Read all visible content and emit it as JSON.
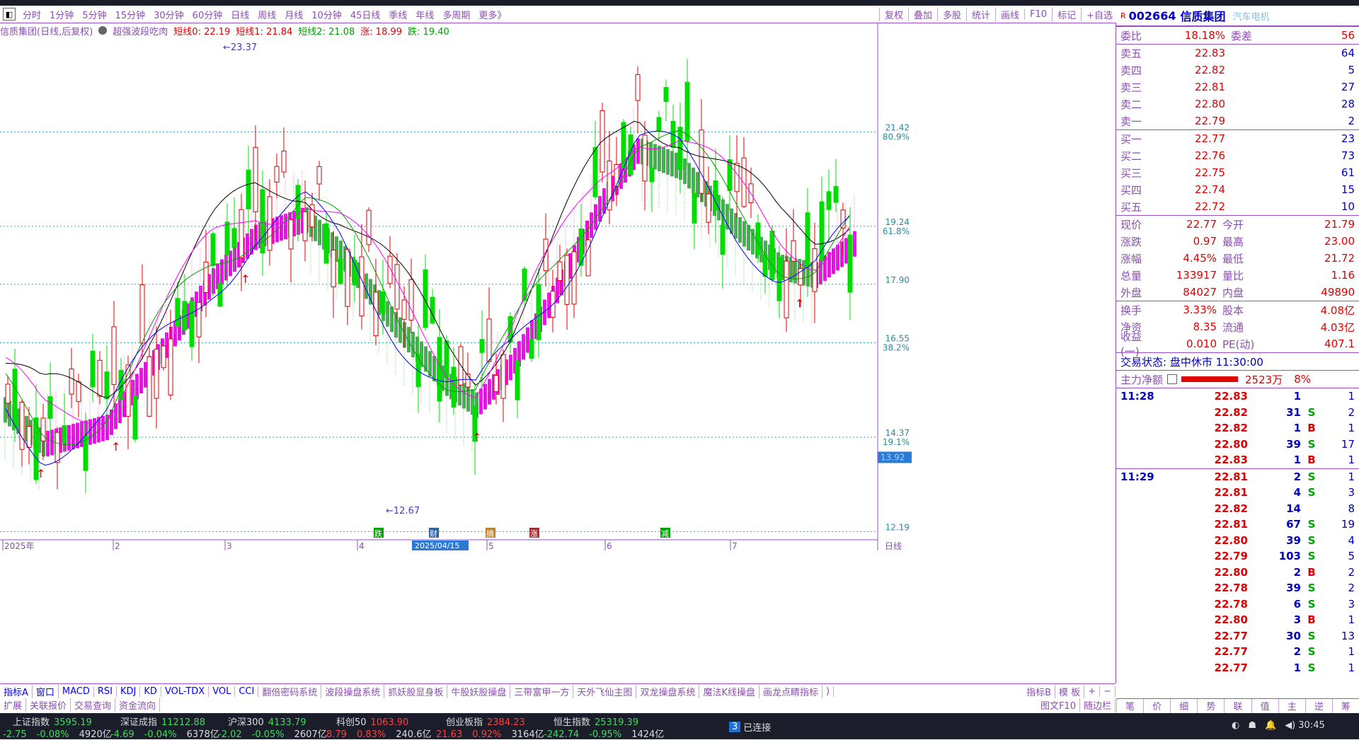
{
  "topbar": {
    "tabs": [
      "分时",
      "1分钟",
      "5分钟",
      "15分钟",
      "30分钟",
      "60分钟",
      "日线",
      "周线",
      "月线",
      "10分钟",
      "45日线",
      "季线",
      "年线",
      "多周期",
      "更多》"
    ],
    "right_buttons": [
      "复权",
      "叠加",
      "多股",
      "统计",
      "画线",
      "F10",
      "标记",
      "+自选",
      "返回"
    ]
  },
  "indicator_line": {
    "name": "信质集团(日线,后复权)",
    "formula": "超强波段吃肉",
    "items": [
      {
        "label": "短线0:",
        "value": "22.19",
        "color": "#e00000"
      },
      {
        "label": "短线1:",
        "value": "21.84",
        "color": "#e00000"
      },
      {
        "label": "短线2:",
        "value": "21.08",
        "color": "#00a000"
      },
      {
        "label": "涨:",
        "value": "18.99",
        "color": "#e00000"
      },
      {
        "label": "跌:",
        "value": "19.40",
        "color": "#00a000"
      }
    ]
  },
  "price_axis": [
    {
      "price": "21.42",
      "pct": "80.9%"
    },
    {
      "price": "19.24",
      "pct": "61.8%"
    },
    {
      "price": "17.90",
      "pct": ""
    },
    {
      "price": "16.55",
      "pct": "38.2%"
    },
    {
      "price": "14.37",
      "pct": "19.1%"
    },
    {
      "price": "12.19",
      "pct": ""
    }
  ],
  "price_markers": {
    "high": "23.37",
    "low": "12.67",
    "current_box": "13.92"
  },
  "x_axis": {
    "labels": [
      "2025年",
      "2",
      "3",
      "4",
      "5",
      "6",
      "7"
    ],
    "selected_date": "2025/04/15",
    "unit": "日线"
  },
  "event_marks": [
    "跌",
    "财",
    "摘",
    "涨",
    "减"
  ],
  "bottom_tabs_row1": [
    "指标A",
    "窗口",
    "MACD",
    "RSI",
    "KDJ",
    "KD",
    "VOL-TDX",
    "VOL",
    "CCI",
    "翻倍密码系统",
    "波段操盘系统",
    "抓妖股显身板",
    "牛股妖股操盘",
    "三带富甲一方",
    "天外飞仙主图",
    "双龙操盘系统",
    "魔法K线操盘",
    "画龙点睛指标",
    ")"
  ],
  "bottom_tabs_row1_right": [
    "指标B",
    "模 板",
    "+",
    "−"
  ],
  "bottom_tabs_row2": [
    "扩展",
    "关联报价",
    "交易查询",
    "资金流向"
  ],
  "bottom_tabs_row2_right": [
    "图文F10",
    "随边栏"
  ],
  "stock": {
    "code": "002664",
    "name": "信质集团",
    "sector": "汽车电机"
  },
  "order_ratio": {
    "label1": "委比",
    "v1": "18.18%",
    "label2": "委差",
    "v2": "56"
  },
  "asks": [
    {
      "label": "卖五",
      "price": "22.83",
      "vol": "64"
    },
    {
      "label": "卖四",
      "price": "22.82",
      "vol": "5"
    },
    {
      "label": "卖三",
      "price": "22.81",
      "vol": "27"
    },
    {
      "label": "卖二",
      "price": "22.80",
      "vol": "28"
    },
    {
      "label": "卖一",
      "price": "22.79",
      "vol": "2"
    }
  ],
  "bids": [
    {
      "label": "买一",
      "price": "22.77",
      "vol": "23"
    },
    {
      "label": "买二",
      "price": "22.76",
      "vol": "73"
    },
    {
      "label": "买三",
      "price": "22.75",
      "vol": "61"
    },
    {
      "label": "买四",
      "price": "22.74",
      "vol": "15"
    },
    {
      "label": "买五",
      "price": "22.72",
      "vol": "10"
    }
  ],
  "quote_block1": [
    {
      "l1": "现价",
      "v1": "22.77",
      "l2": "今开",
      "v2": "21.79"
    },
    {
      "l1": "涨跌",
      "v1": "0.97",
      "l2": "最高",
      "v2": "23.00"
    },
    {
      "l1": "涨幅",
      "v1": "4.45%",
      "l2": "最低",
      "v2": "21.72"
    },
    {
      "l1": "总量",
      "v1": "133917",
      "l2": "量比",
      "v2": "1.16"
    },
    {
      "l1": "外盘",
      "v1": "84027",
      "l2": "内盘",
      "v2": "49890"
    }
  ],
  "quote_block2": [
    {
      "l1": "换手",
      "v1": "3.33%",
      "l2": "股本",
      "v2": "4.08亿"
    },
    {
      "l1": "净资",
      "v1": "8.35",
      "l2": "流通",
      "v2": "4.03亿"
    },
    {
      "l1": "收益(一)",
      "v1": "0.010",
      "l2": "PE(动)",
      "v2": "407.1"
    }
  ],
  "trade_status": "交易状态: 盘中休市 11:30:00",
  "main_fund": {
    "label": "主力净额",
    "value": "2523万",
    "pct": "8%"
  },
  "ticks": [
    {
      "time": "11:28",
      "price": "22.83",
      "vol": "1",
      "flag": "",
      "n": "1"
    },
    {
      "time": "",
      "price": "22.82",
      "vol": "31",
      "flag": "S",
      "n": "2"
    },
    {
      "time": "",
      "price": "22.82",
      "vol": "1",
      "flag": "B",
      "n": "1"
    },
    {
      "time": "",
      "price": "22.80",
      "vol": "39",
      "flag": "S",
      "n": "17"
    },
    {
      "time": "",
      "price": "22.83",
      "vol": "1",
      "flag": "B",
      "n": "1"
    },
    {
      "time": "11:29",
      "price": "22.81",
      "vol": "2",
      "flag": "S",
      "n": "1"
    },
    {
      "time": "",
      "price": "22.81",
      "vol": "4",
      "flag": "S",
      "n": "3"
    },
    {
      "time": "",
      "price": "22.82",
      "vol": "14",
      "flag": "",
      "n": "8"
    },
    {
      "time": "",
      "price": "22.81",
      "vol": "67",
      "flag": "S",
      "n": "19"
    },
    {
      "time": "",
      "price": "22.80",
      "vol": "39",
      "flag": "S",
      "n": "4"
    },
    {
      "time": "",
      "price": "22.79",
      "vol": "103",
      "flag": "S",
      "n": "5"
    },
    {
      "time": "",
      "price": "22.80",
      "vol": "2",
      "flag": "B",
      "n": "2"
    },
    {
      "time": "",
      "price": "22.78",
      "vol": "39",
      "flag": "S",
      "n": "2"
    },
    {
      "time": "",
      "price": "22.78",
      "vol": "6",
      "flag": "S",
      "n": "3"
    },
    {
      "time": "",
      "price": "22.80",
      "vol": "3",
      "flag": "B",
      "n": "1"
    },
    {
      "time": "",
      "price": "22.77",
      "vol": "30",
      "flag": "S",
      "n": "13"
    },
    {
      "time": "",
      "price": "22.77",
      "vol": "2",
      "flag": "S",
      "n": "1"
    },
    {
      "time": "",
      "price": "22.77",
      "vol": "1",
      "flag": "S",
      "n": "1"
    }
  ],
  "right_bottom_tabs": [
    "笔",
    "价",
    "细",
    "势",
    "联",
    "值",
    "主",
    "逆",
    "筹"
  ],
  "footer": {
    "indices": [
      {
        "name": "上证指数",
        "point": "3595.19",
        "chg": "-2.75",
        "pct": "-0.08%",
        "amt": "4920亿",
        "down": true
      },
      {
        "name": "深证成指",
        "point": "11212.88",
        "chg": "-4.69",
        "pct": "-0.04%",
        "amt": "6378亿",
        "down": true
      },
      {
        "name": "沪深300",
        "point": "4133.79",
        "chg": "-2.02",
        "pct": "-0.05%",
        "amt": "2607亿",
        "down": true
      },
      {
        "name": "科创50",
        "point": "1063.90",
        "chg": "8.79",
        "pct": "0.83%",
        "amt": "240.6亿",
        "down": false
      },
      {
        "name": "创业板指",
        "point": "2384.23",
        "chg": "21.63",
        "pct": "0.92%",
        "amt": "3164亿",
        "down": false
      },
      {
        "name": "恒生指数",
        "point": "25319.39",
        "chg": "-242.74",
        "pct": "-0.95%",
        "amt": "1424亿",
        "down": true
      }
    ],
    "conn_count": "3",
    "conn_text": "已连接",
    "clock": "30:45"
  }
}
